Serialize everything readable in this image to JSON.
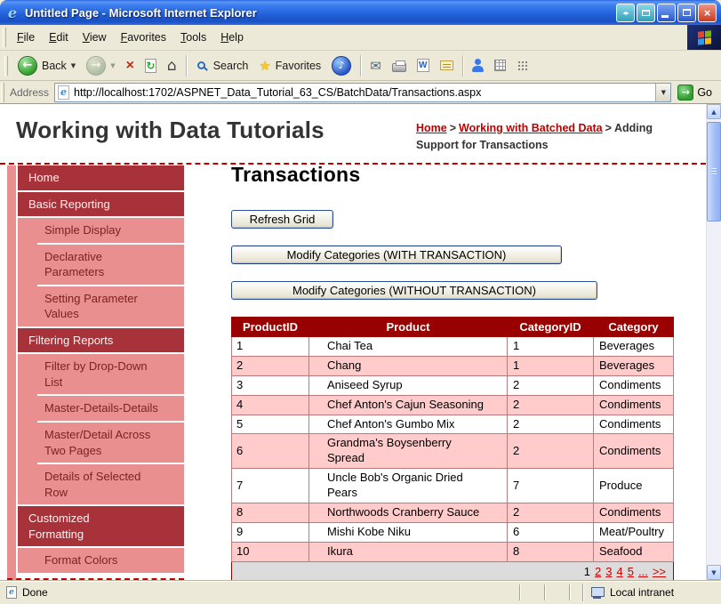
{
  "window": {
    "title": "Untitled Page - Microsoft Internet Explorer"
  },
  "menu_bar": {
    "items": [
      "File",
      "Edit",
      "View",
      "Favorites",
      "Tools",
      "Help"
    ]
  },
  "toolbar": {
    "back": "Back",
    "search": "Search",
    "favorites": "Favorites"
  },
  "address_bar": {
    "label": "Address",
    "url": "http://localhost:1702/ASPNET_Data_Tutorial_63_CS/BatchData/Transactions.aspx",
    "go": "Go"
  },
  "page": {
    "site_title": "Working with Data Tutorials",
    "breadcrumb": {
      "home": "Home",
      "sep": ">",
      "parent": "Working with Batched Data",
      "current": "Adding Support for Transactions"
    },
    "sidebar": {
      "items": [
        "Home",
        "Basic Reporting",
        "Simple Display",
        "Declarative Parameters",
        "Setting Parameter Values",
        "Filtering Reports",
        "Filter by Drop-Down List",
        "Master-Details-Details",
        "Master/Detail Across Two Pages",
        "Details of Selected Row",
        "Customized Formatting",
        "Format Colors"
      ]
    },
    "main": {
      "heading": "Transactions",
      "refresh_button": "Refresh Grid",
      "with_transaction_button": "Modify Categories (WITH TRANSACTION)",
      "without_transaction_button": "Modify Categories (WITHOUT TRANSACTION)",
      "table": {
        "headers": [
          "ProductID",
          "Product",
          "CategoryID",
          "Category"
        ],
        "rows": [
          [
            "1",
            "Chai Tea",
            "1",
            "Beverages"
          ],
          [
            "2",
            "Chang",
            "1",
            "Beverages"
          ],
          [
            "3",
            "Aniseed Syrup",
            "2",
            "Condiments"
          ],
          [
            "4",
            "Chef Anton's Cajun Seasoning",
            "2",
            "Condiments"
          ],
          [
            "5",
            "Chef Anton's Gumbo Mix",
            "2",
            "Condiments"
          ],
          [
            "6",
            "Grandma's Boysenberry Spread",
            "2",
            "Condiments"
          ],
          [
            "7",
            "Uncle Bob's Organic Dried Pears",
            "7",
            "Produce"
          ],
          [
            "8",
            "Northwoods Cranberry Sauce",
            "2",
            "Condiments"
          ],
          [
            "9",
            "Mishi Kobe Niku",
            "6",
            "Meat/Poultry"
          ],
          [
            "10",
            "Ikura",
            "8",
            "Seafood"
          ]
        ],
        "pager": {
          "current": "1",
          "pages": [
            "2",
            "3",
            "4",
            "5"
          ],
          "more": "...",
          "next": ">>"
        }
      }
    }
  },
  "status_bar": {
    "left": "Done",
    "zone": "Local intranet"
  },
  "colors": {
    "accent_maroon": "#990000",
    "sidebar_dark": "#A8323A",
    "sidebar_pink": "#E98F8F",
    "row_pink": "#FFCBCB",
    "link_red": "#CC0000",
    "titlebar_blue": "#215FD8"
  }
}
